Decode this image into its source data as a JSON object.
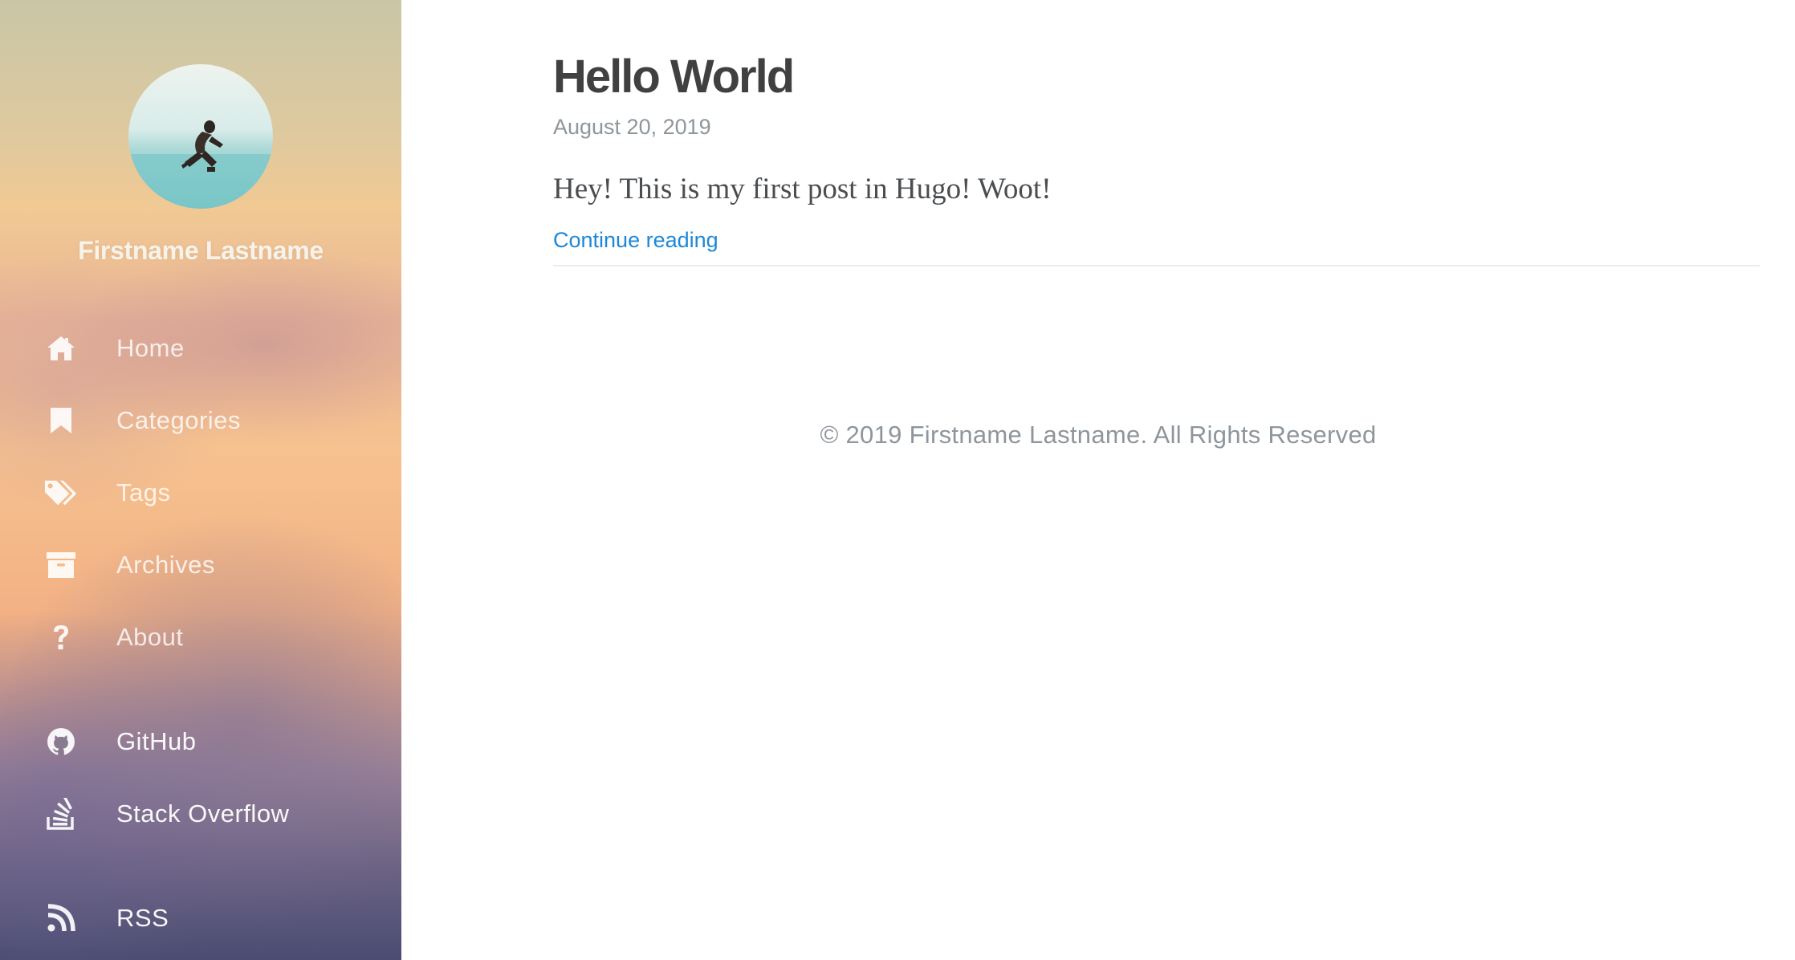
{
  "sidebar": {
    "avatar_alt": "Author avatar",
    "author_name": "Firstname Lastname",
    "nav": [
      {
        "label": "Home",
        "icon": "home-icon"
      },
      {
        "label": "Categories",
        "icon": "bookmark-icon"
      },
      {
        "label": "Tags",
        "icon": "tags-icon"
      },
      {
        "label": "Archives",
        "icon": "archive-icon"
      },
      {
        "label": "About",
        "icon": "question-icon"
      }
    ],
    "social": [
      {
        "label": "GitHub",
        "icon": "github-icon"
      },
      {
        "label": "Stack Overflow",
        "icon": "stackoverflow-icon"
      }
    ],
    "feed": {
      "label": "RSS",
      "icon": "rss-icon"
    }
  },
  "post": {
    "title": "Hello World",
    "date": "August 20, 2019",
    "summary": "Hey! This is my first post in Hugo! Woot!",
    "read_more": "Continue reading"
  },
  "footer": {
    "copyright": "© 2019 Firstname Lastname. All Rights Reserved"
  },
  "colors": {
    "link": "#1e88d8",
    "title": "#404040",
    "muted": "#8e969c",
    "sidebar_text": "#ffffff"
  }
}
